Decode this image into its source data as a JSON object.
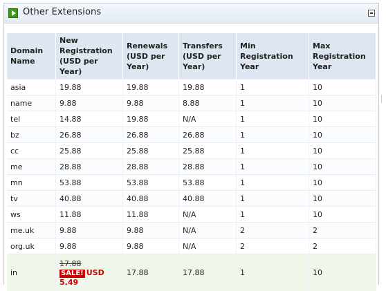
{
  "panel": {
    "title": "Other Extensions",
    "icon": "play-icon",
    "collapse_icon": "collapse-icon"
  },
  "table": {
    "headers": [
      "Domain Name",
      "New Registration (USD per Year)",
      "Renewals (USD per Year)",
      "Transfers (USD per Year)",
      "Min Registration Year",
      "Max Registration Year"
    ],
    "rows": [
      [
        "asia",
        "19.88",
        "19.88",
        "19.88",
        "1",
        "10"
      ],
      [
        "name",
        "9.88",
        "9.88",
        "8.88",
        "1",
        "10"
      ],
      [
        "tel",
        "14.88",
        "19.88",
        "N/A",
        "1",
        "10"
      ],
      [
        "bz",
        "26.88",
        "26.88",
        "26.88",
        "1",
        "10"
      ],
      [
        "cc",
        "25.88",
        "25.88",
        "25.88",
        "1",
        "10"
      ],
      [
        "me",
        "28.88",
        "28.88",
        "28.88",
        "1",
        "10"
      ],
      [
        "mn",
        "53.88",
        "53.88",
        "53.88",
        "1",
        "10"
      ],
      [
        "tv",
        "40.88",
        "40.88",
        "40.88",
        "1",
        "10"
      ],
      [
        "ws",
        "11.88",
        "11.88",
        "N/A",
        "1",
        "10"
      ],
      [
        "me.uk",
        "9.88",
        "9.88",
        "N/A",
        "2",
        "2"
      ],
      [
        "org.uk",
        "9.88",
        "9.88",
        "N/A",
        "2",
        "2"
      ]
    ],
    "sale_row": {
      "domain": "in",
      "old_price": "17.88",
      "sale_badge": "SALE!",
      "sale_price_line1": "USD",
      "sale_price_line2": "5.49",
      "renewal": "17.88",
      "transfer": "17.88",
      "min": "1",
      "max": "10"
    }
  },
  "colors": {
    "header_bg": "#dde6f1",
    "sale_red": "#cc0000",
    "sale_row_bg": "#eef7ea",
    "icon_green": "#3a9a19"
  }
}
